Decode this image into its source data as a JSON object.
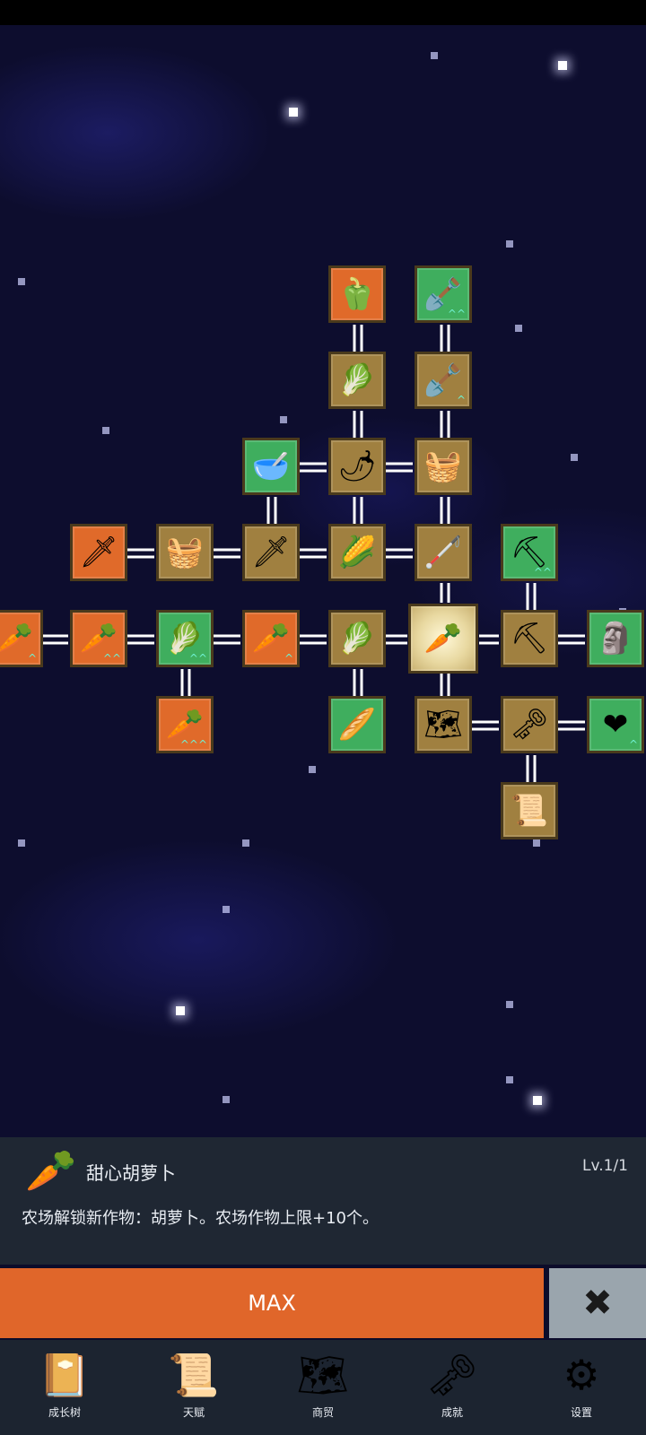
{
  "skill_tree": {
    "nodes": [
      {
        "id": "pepper",
        "icon": "bell-pepper-icon",
        "glyph": "🫑",
        "color": "orange"
      },
      {
        "id": "shovel-top",
        "icon": "shovel-icon",
        "glyph": "🪏",
        "color": "green",
        "upgrade": "^^"
      },
      {
        "id": "radish",
        "icon": "white-radish-icon",
        "glyph": "🥬",
        "color": "brown"
      },
      {
        "id": "shovel-mid",
        "icon": "shovel-icon",
        "glyph": "🪏",
        "color": "brown",
        "upgrade": "^"
      },
      {
        "id": "bowl",
        "icon": "bowl-icon",
        "glyph": "🥣",
        "color": "green"
      },
      {
        "id": "chili",
        "icon": "chili-icon",
        "glyph": "🌶",
        "color": "brown"
      },
      {
        "id": "chest-top",
        "icon": "chest-icon",
        "glyph": "🧺",
        "color": "brown"
      },
      {
        "id": "sword-left",
        "icon": "sword-icon",
        "glyph": "🗡",
        "color": "orange"
      },
      {
        "id": "chest-left",
        "icon": "chest-icon",
        "glyph": "🧺",
        "color": "brown"
      },
      {
        "id": "sword-mid",
        "icon": "sword-icon",
        "glyph": "🗡",
        "color": "brown"
      },
      {
        "id": "corn",
        "icon": "corn-icon",
        "glyph": "🌽",
        "color": "brown"
      },
      {
        "id": "hoe",
        "icon": "hoe-icon",
        "glyph": "🦯",
        "color": "brown"
      },
      {
        "id": "pickaxe-top",
        "icon": "pickaxe-icon",
        "glyph": "⛏",
        "color": "green",
        "upgrade": "^^"
      },
      {
        "id": "carrot-edge",
        "icon": "carrot-icon",
        "glyph": "🥕",
        "color": "orange",
        "upgrade": "^"
      },
      {
        "id": "carrot-2",
        "icon": "carrot-icon",
        "glyph": "🥕",
        "color": "orange",
        "upgrade": "^^"
      },
      {
        "id": "cabbage-left",
        "icon": "cabbage-icon",
        "glyph": "🥬",
        "color": "green",
        "upgrade": "^^"
      },
      {
        "id": "carrot-3",
        "icon": "carrot-icon",
        "glyph": "🥕",
        "color": "orange",
        "upgrade": "^"
      },
      {
        "id": "cabbage-mid",
        "icon": "cabbage-icon",
        "glyph": "🥬",
        "color": "brown"
      },
      {
        "id": "carrot-selected",
        "icon": "carrot-icon",
        "glyph": "🥕",
        "color": "selected"
      },
      {
        "id": "pickaxe-mid",
        "icon": "pickaxe-icon",
        "glyph": "⛏",
        "color": "brown"
      },
      {
        "id": "statue",
        "icon": "statue-icon",
        "glyph": "🗿",
        "color": "green"
      },
      {
        "id": "carrot-low",
        "icon": "carrot-icon",
        "glyph": "🥕",
        "color": "orange",
        "upgrade": "^^^"
      },
      {
        "id": "parsnip",
        "icon": "parsnip-icon",
        "glyph": "🥖",
        "color": "green"
      },
      {
        "id": "map",
        "icon": "map-icon",
        "glyph": "🗺",
        "color": "brown"
      },
      {
        "id": "key",
        "icon": "golden-key-icon",
        "glyph": "🗝",
        "color": "brown"
      },
      {
        "id": "heart",
        "icon": "heart-icon",
        "glyph": "❤",
        "color": "green",
        "upgrade": "^"
      },
      {
        "id": "scroll",
        "icon": "scroll-icon",
        "glyph": "📜",
        "color": "brown"
      }
    ]
  },
  "detail": {
    "icon": "carrot-icon",
    "glyph": "🥕",
    "title": "甜心胡萝卜",
    "level": "Lv.1/1",
    "description": "农场解锁新作物：胡萝卜。农场作物上限+10个。"
  },
  "actions": {
    "max_label": "MAX",
    "close_glyph": "✖"
  },
  "nav": [
    {
      "label": "成长树",
      "icon": "book-icon",
      "glyph": "📔"
    },
    {
      "label": "天赋",
      "icon": "scroll-icon",
      "glyph": "📜"
    },
    {
      "label": "商贸",
      "icon": "map-icon",
      "glyph": "🗺"
    },
    {
      "label": "成就",
      "icon": "golden-key-icon",
      "glyph": "🗝"
    },
    {
      "label": "设置",
      "icon": "gear-icon",
      "glyph": "⚙"
    }
  ],
  "colors": {
    "brown": "#a08040",
    "green": "#3fae5e",
    "orange": "#e06a2a",
    "max_button": "#e0662a",
    "close_button": "#9aa5ad",
    "panel": "#1f2733"
  }
}
